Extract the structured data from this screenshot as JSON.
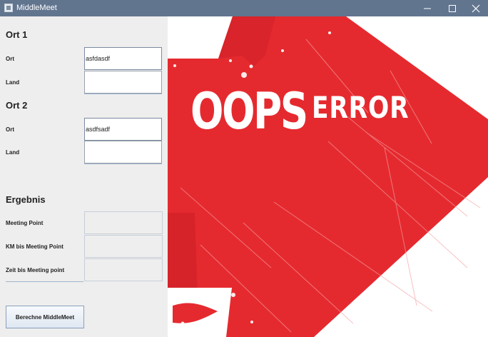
{
  "window": {
    "title": "MiddleMeet",
    "controls": {
      "minimize": "—",
      "maximize": "☐",
      "close": "✕"
    }
  },
  "form": {
    "ort1": {
      "heading": "Ort 1",
      "ort_label": "Ort",
      "ort_value": "asfdasdf",
      "land_label": "Land",
      "land_value": ""
    },
    "ort2": {
      "heading": "Ort 2",
      "ort_label": "Ort",
      "ort_value": "asdfsadf",
      "land_label": "Land",
      "land_value": ""
    },
    "result": {
      "heading": "Ergebnis",
      "meeting_point_label": "Meeting Point",
      "km_label": "KM bis Meeting Point",
      "time_label": "Zeit bis Meeting point"
    },
    "button_label": "Berechne MiddleMeet"
  },
  "image": {
    "oops_text": "OOPS",
    "error_text": "ERROR",
    "colors": {
      "primary": "#e52a2f",
      "dark": "#c91f25",
      "background": "#ffffff"
    }
  },
  "colors": {
    "titlebar": "#62758f",
    "panel": "#eeeeee",
    "accent_line": "#9fb4cc"
  }
}
